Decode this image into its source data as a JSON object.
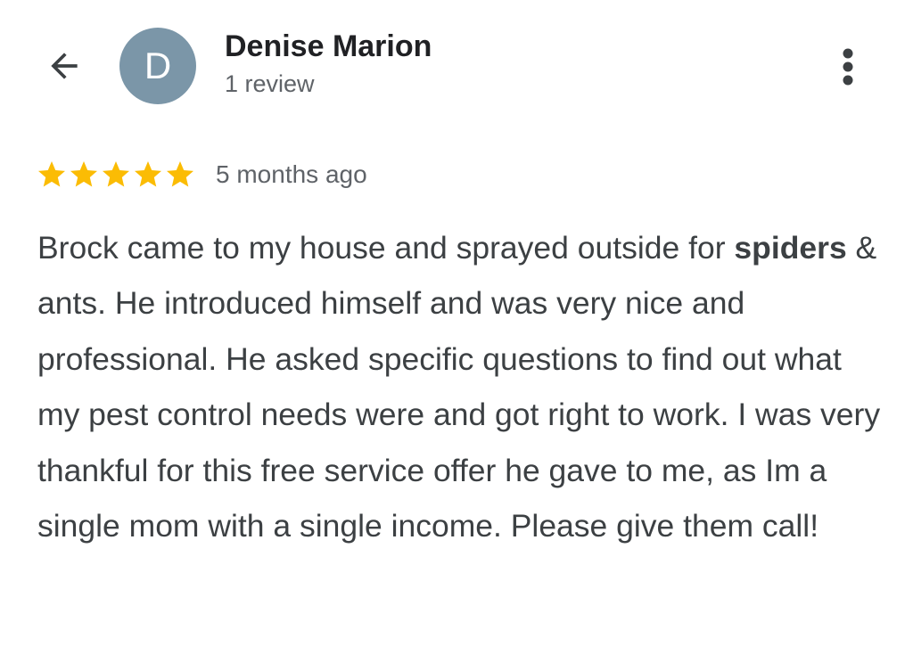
{
  "header": {
    "back_icon": "arrow-back-icon",
    "avatar": {
      "initial": "D",
      "color": "#7b96a8"
    },
    "reviewer_name": "Denise Marion",
    "review_count": "1 review",
    "more_icon": "more-vert-icon"
  },
  "review": {
    "rating": 5,
    "star_color": "#fbbc04",
    "date": "5 months ago",
    "text_before_bold": "Brock came to my house and sprayed outside for ",
    "bold_word": "spiders",
    "text_after_bold": " & ants. He introduced himself and was very nice and professional. He asked specific questions to find out what my pest control needs were and got right to work. I was very thankful for this free service offer he gave to me, as Im a single mom with a single income. Please give them call!"
  }
}
